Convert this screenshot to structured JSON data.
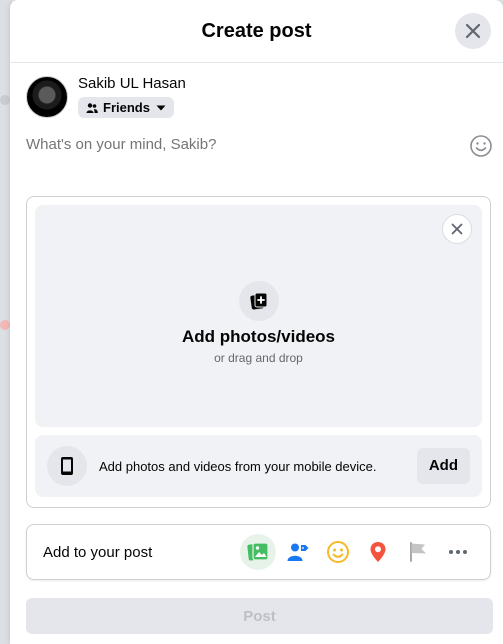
{
  "header": {
    "title": "Create post"
  },
  "user": {
    "name": "Sakib UL Hasan",
    "audience": "Friends"
  },
  "composer": {
    "placeholder": "What's on your mind, Sakib?"
  },
  "media": {
    "title": "Add photos/videos",
    "subtitle": "or drag and drop",
    "mobile_text": "Add photos and videos from your mobile device.",
    "mobile_add_label": "Add"
  },
  "add_to_post": {
    "label": "Add to your post",
    "icons": [
      "photo-video-icon",
      "tag-people-icon",
      "feeling-icon",
      "check-in-icon",
      "life-event-flag-icon",
      "more-icon"
    ]
  },
  "post": {
    "label": "Post"
  },
  "colors": {
    "accent_green": "#45bd62",
    "accent_blue": "#1877f2",
    "accent_yellow": "#f7b928",
    "accent_red": "#f5533d",
    "flag_gray": "#a8a8a8"
  }
}
